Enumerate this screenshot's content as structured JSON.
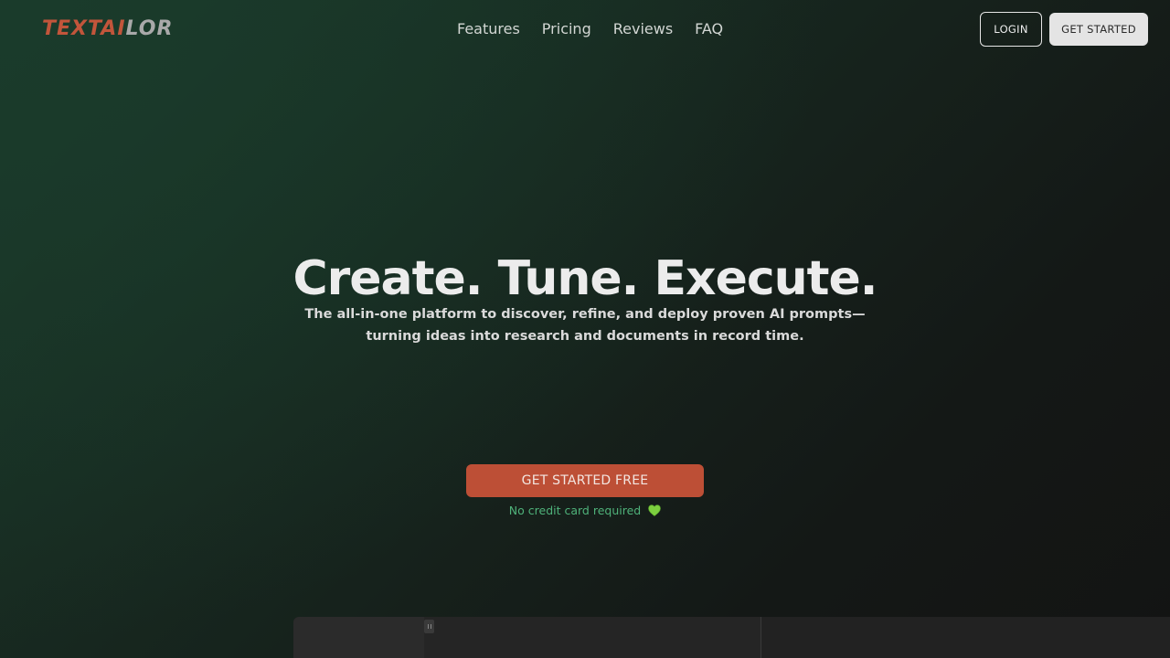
{
  "header": {
    "logo": {
      "accent": "TEXTAI",
      "rest": "LOR"
    },
    "nav": [
      {
        "label": "Features"
      },
      {
        "label": "Pricing"
      },
      {
        "label": "Reviews"
      },
      {
        "label": "FAQ"
      }
    ],
    "login_label": "LOGIN",
    "get_started_label": "GET STARTED"
  },
  "hero": {
    "title": "Create. Tune. Execute.",
    "subtitle": "The all-in-one platform to discover, refine, and deploy proven AI prompts—turning ideas into research and documents in record time.",
    "cta_label": "GET STARTED FREE",
    "cta_note": "No credit card required",
    "note_icon": "green-heart-icon"
  },
  "colors": {
    "brand_accent": "#c2553b",
    "cta_background": "#bd4f36",
    "note_green": "#4fb27a"
  }
}
